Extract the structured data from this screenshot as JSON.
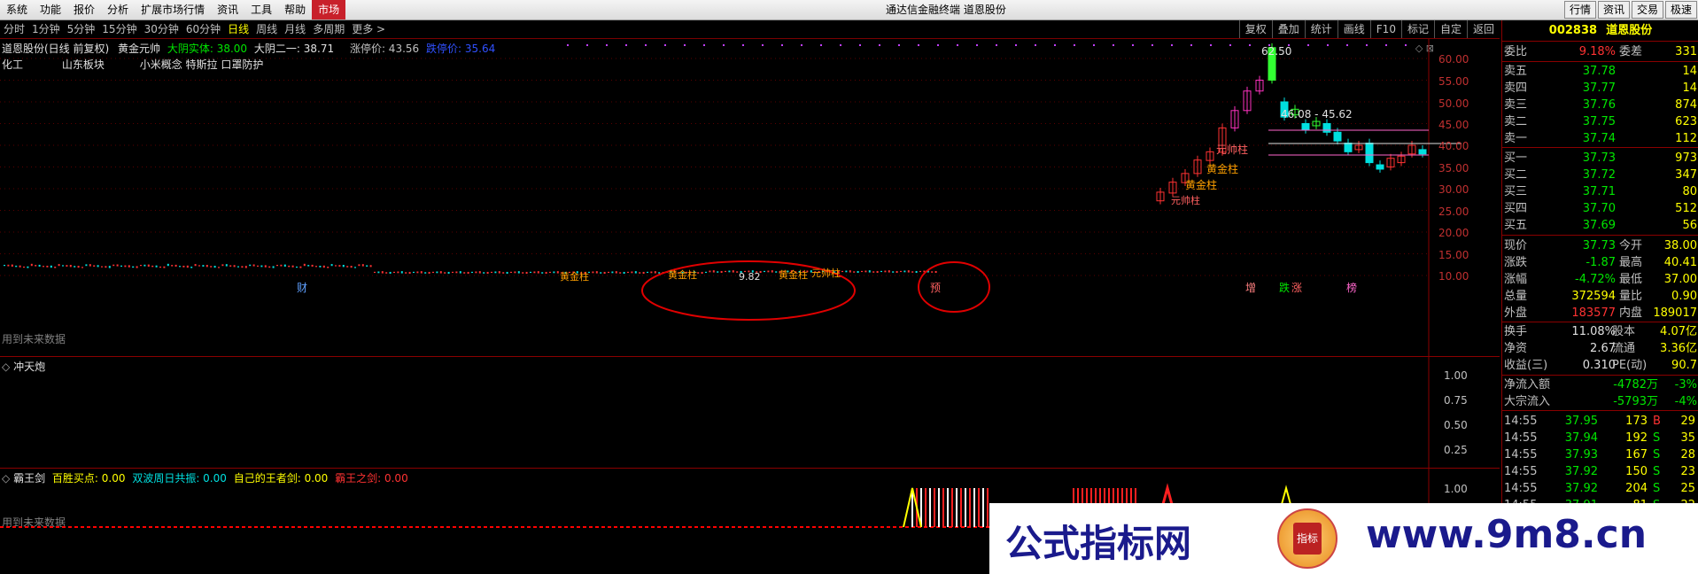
{
  "menubar": {
    "items": [
      "系统",
      "功能",
      "报价",
      "分析",
      "扩展市场行情",
      "资讯",
      "工具",
      "帮助",
      "市场"
    ],
    "title": "通达信金融终端  道恩股份",
    "right_buttons": [
      "行情",
      "资讯",
      "交易",
      "极速"
    ]
  },
  "periodbar": {
    "items": [
      "分时",
      "1分钟",
      "5分钟",
      "15分钟",
      "30分钟",
      "60分钟",
      "日线",
      "周线",
      "月线",
      "多周期",
      "更多 >"
    ],
    "selected": "日线",
    "tools": [
      "复权",
      "叠加",
      "统计",
      "画线",
      "F10",
      "标记",
      "自定",
      "返回"
    ]
  },
  "main_panel": {
    "header_stock": "道恩股份(日线 前复权)",
    "indicator_name": "黄金元帅",
    "ind1": "大阴实体: 38.00",
    "ind2": "大阴二一: 38.71",
    "ind3": "涨停价: 43.56",
    "ind4": "跌停价: 35.64",
    "tags": [
      "化工",
      "山东板块",
      "小米概念 特斯拉 口罩防护"
    ],
    "future_text": "用到未来数据",
    "y_ticks": [
      "60.00",
      "55.00",
      "50.00",
      "45.00",
      "40.00",
      "35.00",
      "30.00",
      "25.00",
      "20.00",
      "15.00",
      "10.00"
    ],
    "high_label": "62.50",
    "range_label": "46.08 - 45.62",
    "low_label": "9.82",
    "chart_texts": [
      "元帅柱",
      "黄金柱",
      "黄金柱",
      "元帅柱",
      "黄金柱",
      "黄金柱",
      "黄金柱",
      "元帅柱"
    ],
    "bottom_flags": [
      "财",
      "预",
      "增",
      "跌",
      "涨",
      "榜"
    ]
  },
  "sub_panel1": {
    "name": "冲天炮",
    "y_ticks": [
      "1.00",
      "0.75",
      "0.50",
      "0.25"
    ]
  },
  "sub_panel2": {
    "name": "霸王剑",
    "l1": "百胜买点: 0.00",
    "l2": "双波周日共振: 0.00",
    "l3": "自己的王者剑: 0.00",
    "l4": "霸王之剑: 0.00",
    "future_text": "用到未来数据",
    "y_ticks": [
      "1.00"
    ]
  },
  "quote": {
    "code": "002838",
    "name": "道恩股份",
    "weibi_label": "委比",
    "weibi": "9.18%",
    "weicha_label": "委差",
    "weicha": "331",
    "asks": [
      {
        "label": "卖五",
        "price": "37.78",
        "vol": "14"
      },
      {
        "label": "卖四",
        "price": "37.77",
        "vol": "14"
      },
      {
        "label": "卖三",
        "price": "37.76",
        "vol": "874"
      },
      {
        "label": "卖二",
        "price": "37.75",
        "vol": "623"
      },
      {
        "label": "卖一",
        "price": "37.74",
        "vol": "112"
      }
    ],
    "bids": [
      {
        "label": "买一",
        "price": "37.73",
        "vol": "973"
      },
      {
        "label": "买二",
        "price": "37.72",
        "vol": "347"
      },
      {
        "label": "买三",
        "price": "37.71",
        "vol": "80"
      },
      {
        "label": "买四",
        "price": "37.70",
        "vol": "512"
      },
      {
        "label": "买五",
        "price": "37.69",
        "vol": "56"
      }
    ],
    "stats": [
      {
        "l1": "现价",
        "v1": "37.73",
        "l2": "今开",
        "v2": "38.00"
      },
      {
        "l1": "涨跌",
        "v1": "-1.87",
        "l2": "最高",
        "v2": "40.41"
      },
      {
        "l1": "涨幅",
        "v1": "-4.72%",
        "l2": "最低",
        "v2": "37.00"
      },
      {
        "l1": "总量",
        "v1": "372594",
        "l2": "量比",
        "v2": "0.90"
      },
      {
        "l1": "外盘",
        "v1": "183577",
        "l2": "内盘",
        "v2": "189017"
      }
    ],
    "stats2": [
      {
        "l1": "换手",
        "v1": "11.08%",
        "l2": "股本",
        "v2": "4.07亿"
      },
      {
        "l1": "净资",
        "v1": "2.67",
        "l2": "流通",
        "v2": "3.36亿"
      },
      {
        "l1": "收益(三)",
        "v1": "0.310",
        "l2": "PE(动)",
        "v2": "90.7"
      }
    ],
    "flows": [
      {
        "label": "净流入额",
        "value": "-4782万",
        "pct": "-3%"
      },
      {
        "label": "大宗流入",
        "value": "-5793万",
        "pct": "-4%"
      }
    ],
    "ticks": [
      {
        "time": "14:55",
        "price": "37.95",
        "vol": "173",
        "side": "B",
        "n": "29"
      },
      {
        "time": "14:55",
        "price": "37.94",
        "vol": "192",
        "side": "S",
        "n": "35"
      },
      {
        "time": "14:55",
        "price": "37.93",
        "vol": "167",
        "side": "S",
        "n": "28"
      },
      {
        "time": "14:55",
        "price": "37.92",
        "vol": "150",
        "side": "S",
        "n": "23"
      },
      {
        "time": "14:55",
        "price": "37.92",
        "vol": "204",
        "side": "S",
        "n": "25"
      },
      {
        "time": "14:55",
        "price": "37.91",
        "vol": "81",
        "side": "S",
        "n": "22"
      }
    ]
  },
  "watermark": {
    "text": "公式指标网",
    "url": "www.9m8.cn",
    "seal": "指标"
  },
  "colors": {
    "up": "#ff3232",
    "down": "#00ffff",
    "axis": "#8a0000",
    "accent": "#c8202a"
  }
}
